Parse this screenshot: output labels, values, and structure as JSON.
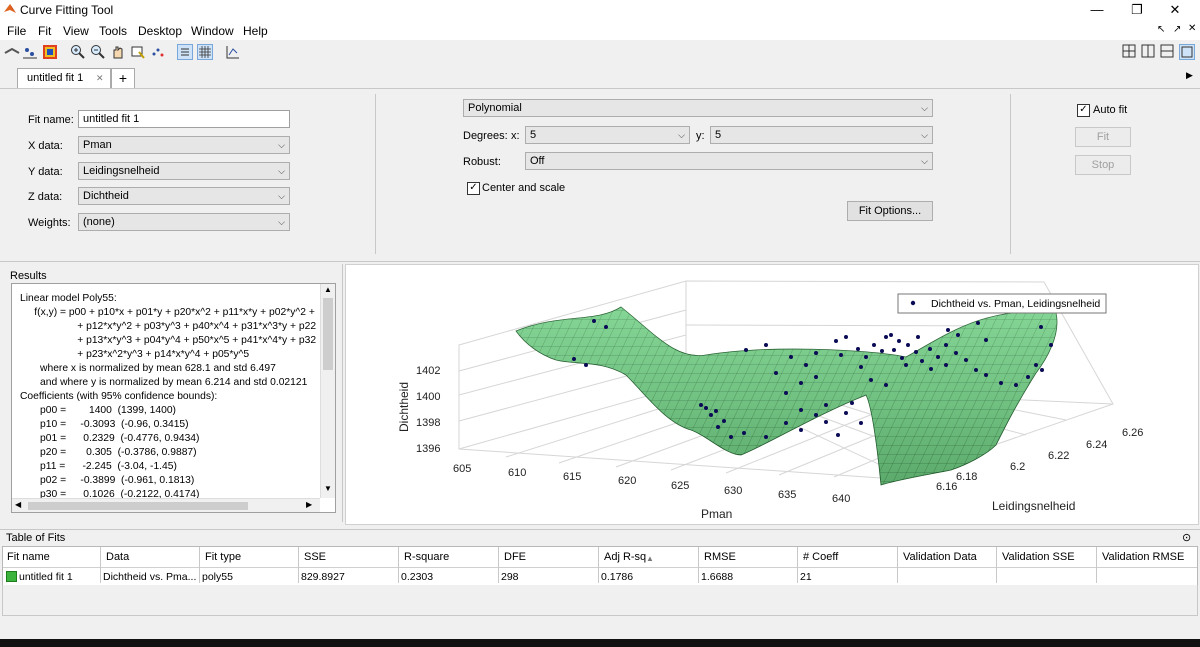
{
  "window": {
    "title": "Curve Fitting Tool",
    "minimize": "—",
    "restore": "❐",
    "close": "✕"
  },
  "menu": [
    "File",
    "Fit",
    "View",
    "Tools",
    "Desktop",
    "Window",
    "Help"
  ],
  "tab": {
    "label": "untitled fit 1",
    "close": "✕",
    "add": "+"
  },
  "fit": {
    "name_label": "Fit name:",
    "name_value": "untitled fit 1",
    "x_label": "X data:",
    "x_value": "Pman",
    "y_label": "Y data:",
    "y_value": "Leidingsnelheid",
    "z_label": "Z data:",
    "z_value": "Dichtheid",
    "w_label": "Weights:",
    "w_value": "(none)",
    "type": "Polynomial",
    "degrees_label": "Degrees:",
    "x_deg_label": "x:",
    "x_deg": "5",
    "y_deg_label": "y:",
    "y_deg": "5",
    "robust_label": "Robust:",
    "robust_value": "Off",
    "center_label": "Center and scale",
    "fit_options": "Fit Options...",
    "autofit_label": "Auto fit",
    "fit_button": "Fit",
    "stop_button": "Stop"
  },
  "results": {
    "title": "Results",
    "lines": [
      "Linear model Poly55:",
      "     f(x,y) = p00 + p10*x + p01*y + p20*x^2 + p11*x*y + p02*y^2 +",
      "                    + p12*x*y^2 + p03*y^3 + p40*x^4 + p31*x^3*y + p22",
      "                    + p13*x*y^3 + p04*y^4 + p50*x^5 + p41*x^4*y + p32",
      "                    + p23*x^2*y^3 + p14*x*y^4 + p05*y^5",
      "       where x is normalized by mean 628.1 and std 6.497",
      "       and where y is normalized by mean 6.214 and std 0.02121",
      "Coefficients (with 95% confidence bounds):",
      "       p00 =        1400  (1399, 1400)",
      "       p10 =     -0.3093  (-0.96, 0.3415)",
      "       p01 =      0.2329  (-0.4776, 0.9434)",
      "       p20 =       0.305  (-0.3786, 0.9887)",
      "       p11 =      -2.245  (-3.04, -1.45)",
      "       p02 =     -0.3899  (-0.961, 0.1813)",
      "       p30 =      0.1026  (-0.2122, 0.4174)"
    ]
  },
  "plot": {
    "legend": "Dichtheid vs. Pman, Leidingsnelheid",
    "zlabel": "Dichtheid",
    "xlabel": "Pman",
    "ylabel": "Leidingsnelheid",
    "zticks": [
      "1396",
      "1398",
      "1400",
      "1402"
    ],
    "xticks": [
      "605",
      "610",
      "615",
      "620",
      "625",
      "630",
      "635",
      "640"
    ],
    "yticks": [
      "6.16",
      "6.18",
      "6.2",
      "6.22",
      "6.24",
      "6.26"
    ],
    "surface_color": "#6fcf83",
    "point_color": "#0b0b55"
  },
  "table": {
    "title": "Table of Fits",
    "headers": [
      "Fit name",
      "Data",
      "Fit type",
      "SSE",
      "R-square",
      "DFE",
      "Adj R-sq",
      "RMSE",
      "# Coeff",
      "Validation Data",
      "Validation SSE",
      "Validation RMSE"
    ],
    "sort_indicator": "▲",
    "row": [
      "untitled fit 1",
      "Dichtheid vs. Pma...",
      "poly55",
      "829.8927",
      "0.2303",
      "298",
      "0.1786",
      "1.6688",
      "21",
      "",
      "",
      ""
    ]
  }
}
